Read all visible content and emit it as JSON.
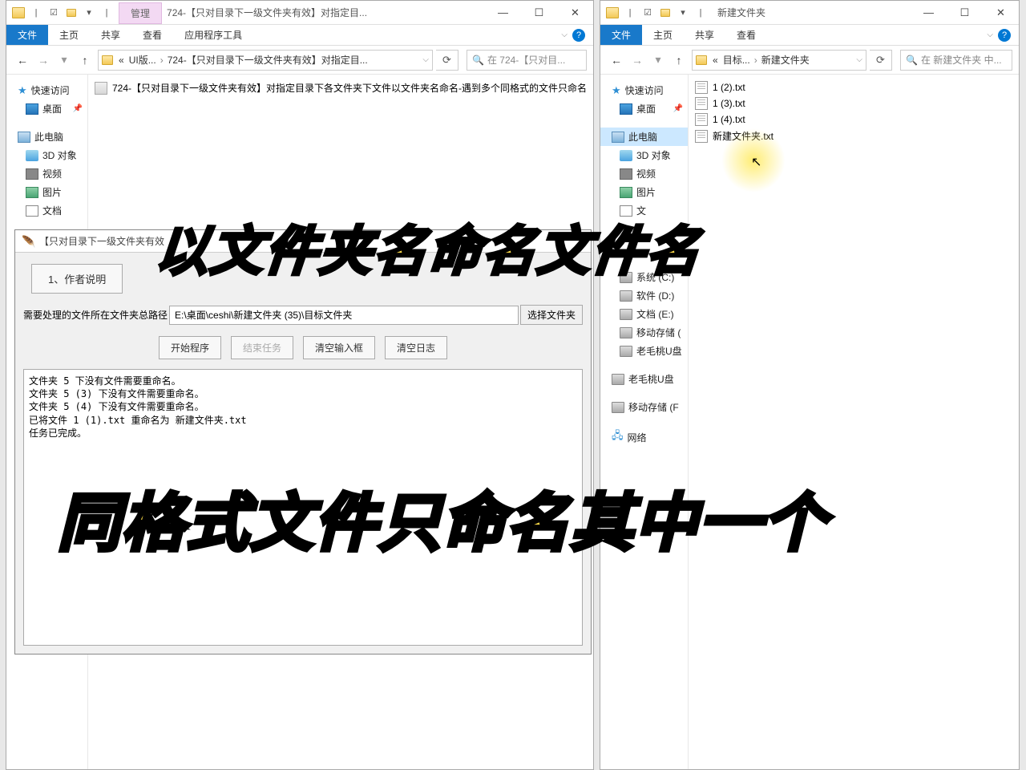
{
  "left_window": {
    "qat_manage": "管理",
    "title": "724-【只对目录下一级文件夹有效】对指定目...",
    "ribbon_tool_tab": "应用程序工具",
    "breadcrumb": {
      "p1": "UI版...",
      "p2": "724-【只对目录下一级文件夹有效】对指定目..."
    },
    "search_placeholder": "在 724-【只对目...",
    "content_file": "724-【只对目录下一级文件夹有效】对指定目录下各文件夹下文件以文件夹名命名-遇到多个同格式的文件只命名"
  },
  "right_window": {
    "title": "新建文件夹",
    "breadcrumb": {
      "p1": "目标...",
      "p2": "新建文件夹"
    },
    "search_placeholder": "在 新建文件夹 中...",
    "files": [
      "1 (2).txt",
      "1 (3).txt",
      "1 (4).txt",
      "新建文件夹.txt"
    ]
  },
  "ribbon": {
    "file": "文件",
    "home": "主页",
    "share": "共享",
    "view": "查看"
  },
  "sidebar": {
    "quick": "快速访问",
    "desktop": "桌面",
    "pc": "此电脑",
    "obj3d": "3D 对象",
    "video": "视频",
    "pics": "图片",
    "docs": "文档",
    "sys_c": "系统 (C:)",
    "soft_d": "软件 (D:)",
    "doc_e": "文档 (E:)",
    "mobile": "移动存储 (",
    "usb1": "老毛桃U盘",
    "usb2": "老毛桃U盘",
    "mobile2": "移动存储 (F",
    "network": "网络"
  },
  "tool": {
    "title_partial": "【只对目录下一级文件夹有效",
    "btn1": "1、作者说明",
    "path_label": "需要处理的文件所在文件夹总路径",
    "path_value": "E:\\桌面\\ceshi\\新建文件夹 (35)\\目标文件夹",
    "browse": "选择文件夹",
    "start": "开始程序",
    "end": "结束任务",
    "clear_input": "清空输入框",
    "clear_log": "清空日志",
    "log": "文件夹 5 下没有文件需要重命名。\n文件夹 5 (3) 下没有文件需要重命名。\n文件夹 5 (4) 下没有文件需要重命名。\n已将文件 1 (1).txt 重命名为 新建文件夹.txt\n任务已完成。"
  },
  "overlay": {
    "line1": "以文件夹名命名文件名",
    "line2": "同格式文件只命名其中一个"
  }
}
